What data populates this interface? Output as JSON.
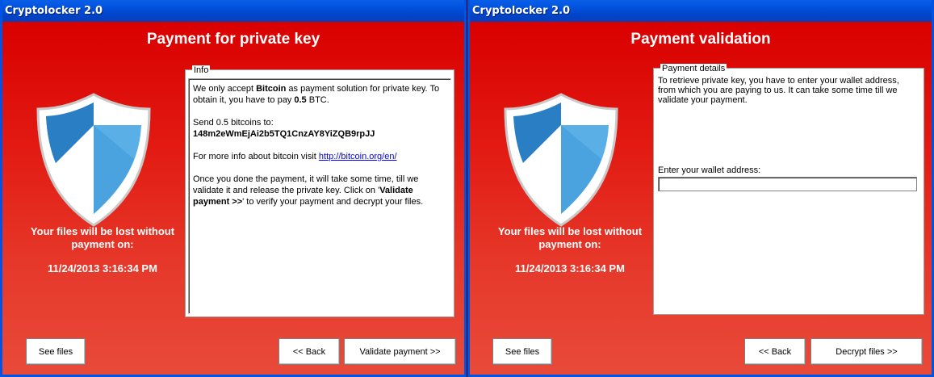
{
  "left_window": {
    "title": "Cryptolocker 2.0",
    "heading": "Payment for private key",
    "lost_text": "Your files will be lost without payment on:",
    "deadline": "11/24/2013 3:16:34 PM",
    "info_legend": "Info",
    "info": {
      "p1_a": "We only accept ",
      "p1_b": "Bitcoin",
      "p1_c": " as payment solution for private key. To obtain it, you have to pay ",
      "p1_d": "0.5",
      "p1_e": " BTC.",
      "send_line": "Send 0.5 bitcoins to:",
      "address": "148m2eWmEjAi2b5TQ1CnzAY8YiZQB9rpJJ",
      "more_info": "For more info about bitcoin visit ",
      "link": "http://bitcoin.org/en/",
      "p4_a": "Once you done the payment, it will take some time, till we validate it and release the private key. Click on '",
      "p4_b": "Validate payment >>",
      "p4_c": "' to verify your payment and decrypt your files."
    },
    "buttons": {
      "see_files": "See files",
      "back": "<< Back",
      "validate": "Validate payment >>"
    }
  },
  "right_window": {
    "title": "Cryptolocker 2.0",
    "heading": "Payment validation",
    "lost_text": "Your files will be lost without payment on:",
    "deadline": "11/24/2013 3:16:34 PM",
    "details_legend": "Payment details",
    "details_text": "To retrieve private key, you have to enter your wallet address, from which you are paying to us. It can take some time till we validate your payment.",
    "wallet_label": "Enter your wallet address:",
    "wallet_value": "",
    "buttons": {
      "see_files": "See files",
      "back": "<< Back",
      "decrypt": "Decrypt files >>"
    }
  },
  "colors": {
    "titlebar": "#0154e0",
    "client_top": "#d90000",
    "client_bottom": "#e84a3a",
    "shield_blue": "#2a7fc4",
    "shield_light": "#5ab0e6"
  },
  "icons": {
    "shield": "shield-icon"
  }
}
